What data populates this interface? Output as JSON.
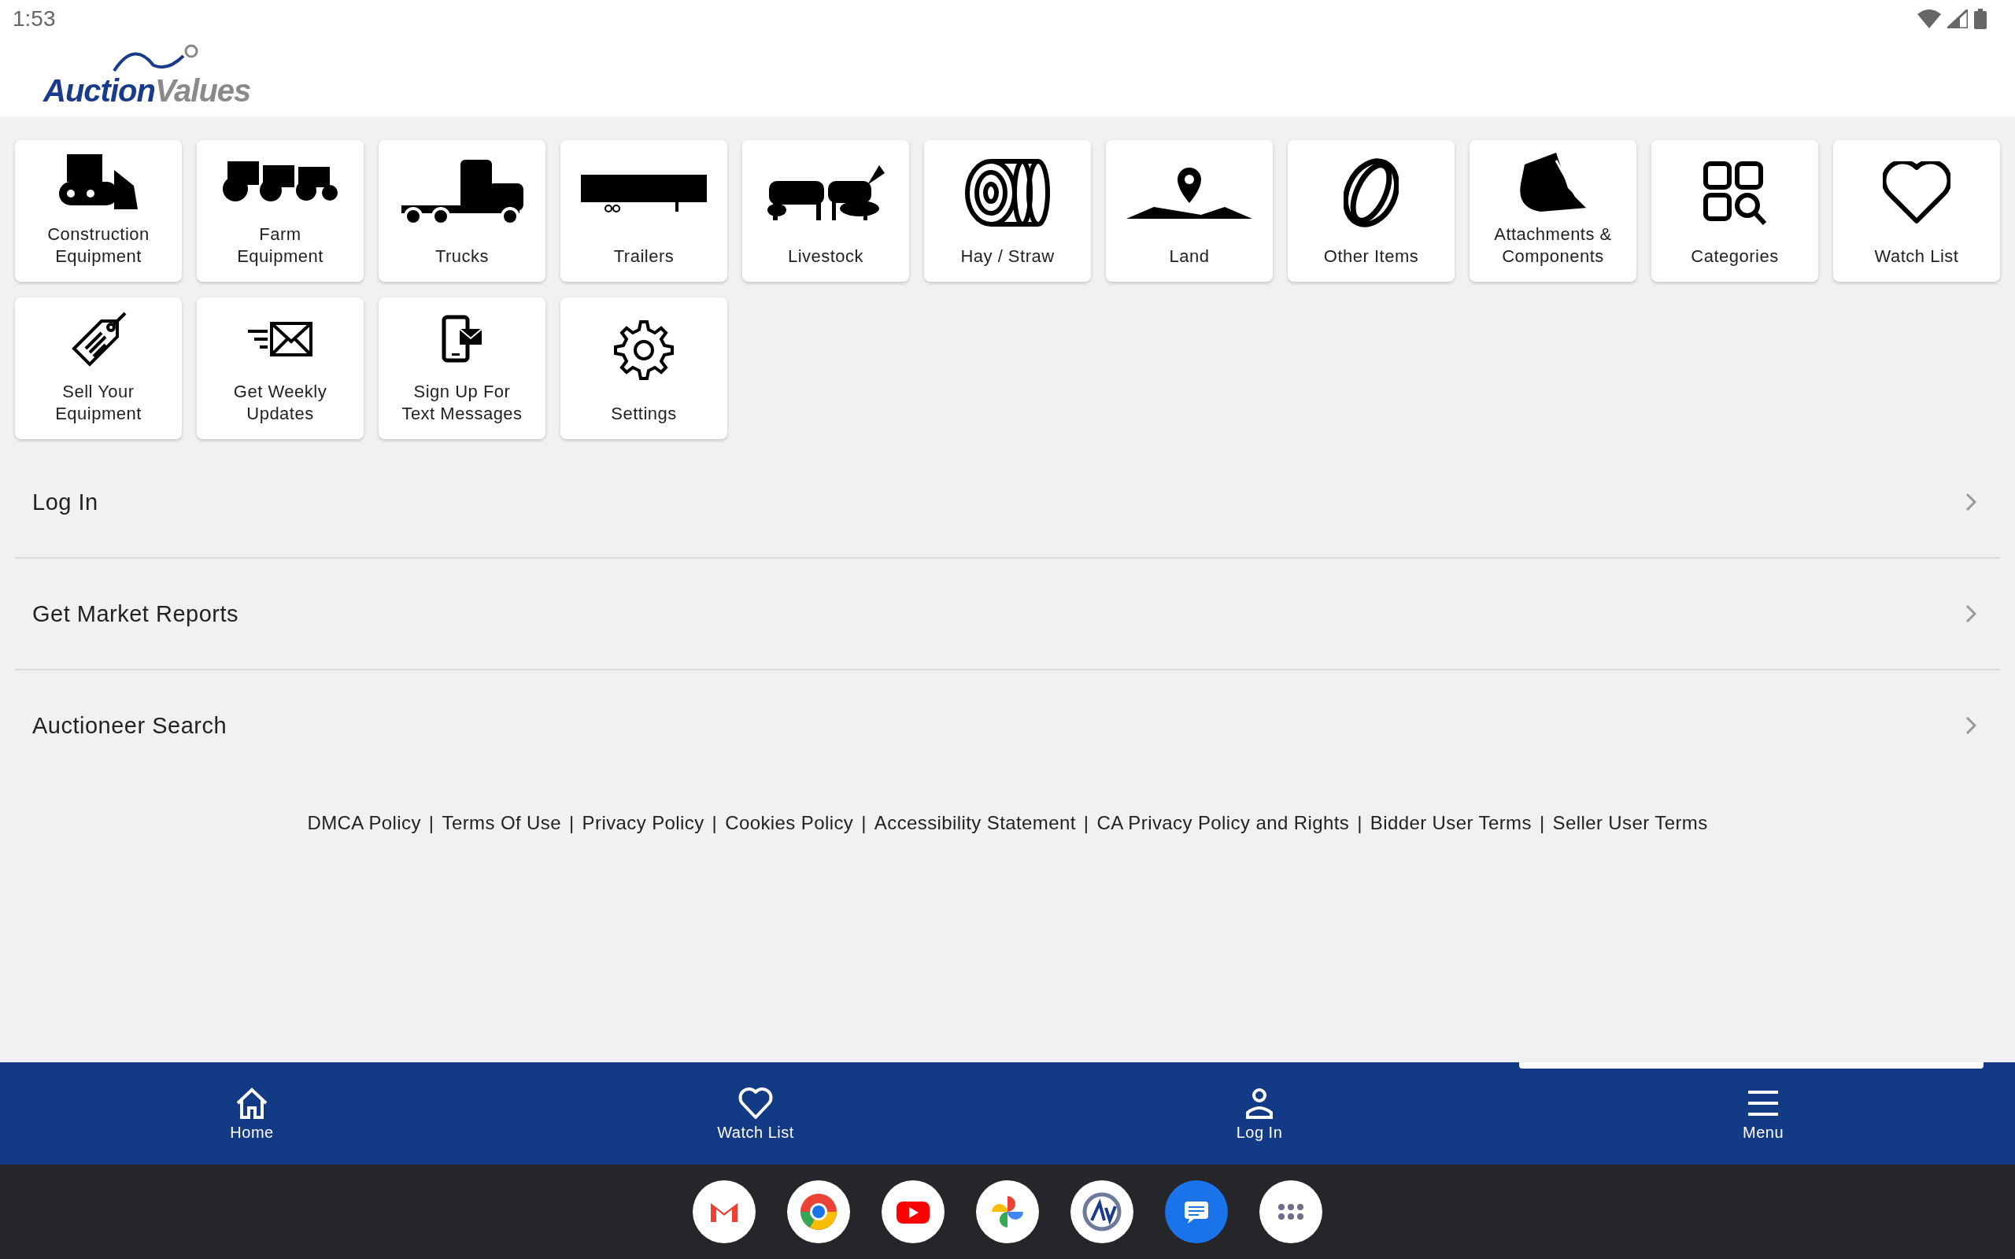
{
  "status_bar": {
    "time": "1:53"
  },
  "logo": {
    "part_1": "Auction",
    "part_2": "Values"
  },
  "tiles": [
    {
      "label": "Construction Equipment"
    },
    {
      "label": "Farm Equipment"
    },
    {
      "label": "Trucks"
    },
    {
      "label": "Trailers"
    },
    {
      "label": "Livestock"
    },
    {
      "label": "Hay / Straw"
    },
    {
      "label": "Land"
    },
    {
      "label": "Other Items"
    },
    {
      "label": "Attachments & Components"
    },
    {
      "label": "Categories"
    },
    {
      "label": "Watch List"
    },
    {
      "label": "Sell Your Equipment"
    },
    {
      "label": "Get Weekly Updates"
    },
    {
      "label": "Sign Up For Text Messages"
    },
    {
      "label": "Settings"
    }
  ],
  "menu_rows": [
    {
      "label": "Log In"
    },
    {
      "label": "Get Market Reports"
    },
    {
      "label": "Auctioneer Search"
    }
  ],
  "footer": {
    "separator": "|",
    "links": [
      "DMCA Policy",
      "Terms Of Use",
      "Privacy Policy",
      "Cookies Policy",
      "Accessibility Statement",
      "CA Privacy Policy and Rights",
      "Bidder User Terms",
      "Seller User Terms"
    ]
  },
  "bottom_nav": [
    {
      "label": "Home"
    },
    {
      "label": "Watch List"
    },
    {
      "label": "Log In"
    },
    {
      "label": "Menu"
    }
  ]
}
